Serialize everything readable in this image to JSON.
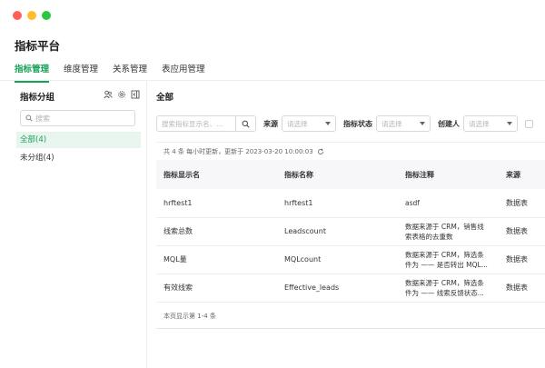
{
  "app": {
    "title": "指标平台"
  },
  "tabs": [
    "指标管理",
    "维度管理",
    "关系管理",
    "表应用管理"
  ],
  "sidebar": {
    "title": "指标分组",
    "search_placeholder": "搜索",
    "items": [
      {
        "label": "全部(4)",
        "active": true
      },
      {
        "label": "未分组(4)",
        "active": false
      }
    ]
  },
  "main": {
    "title": "全部",
    "search_placeholder": "搜索指标显示名、...",
    "filters": [
      {
        "label": "来源",
        "placeholder": "请选择"
      },
      {
        "label": "指标状态",
        "placeholder": "请选择"
      },
      {
        "label": "创建人",
        "placeholder": "请选择"
      }
    ],
    "summary": "共 4 条   每小时更新，更新于 2023-03-20 10:00:03",
    "columns": [
      "指标显示名",
      "指标名称",
      "指标注释",
      "来源"
    ],
    "rows": [
      {
        "display": "hrftest1",
        "name": "hrftest1",
        "note": "asdf",
        "note2": "",
        "source": "数据表"
      },
      {
        "display": "线索总数",
        "name": "Leadscount",
        "note": "数据来源于 CRM，销售线",
        "note2": "索表格的去重数",
        "source": "数据表"
      },
      {
        "display": "MQL量",
        "name": "MQLcount",
        "note": "数据来源于 CRM，筛选条",
        "note2": "件为 —— 是否转出 MQL...",
        "source": "数据表"
      },
      {
        "display": "有效线索",
        "name": "Effective_leads",
        "note": "数据来源于 CRM，筛选条",
        "note2": "件为 —— 线索反馈状态...",
        "source": "数据表"
      }
    ],
    "footer": "本页显示第 1-4 条"
  },
  "colors": {
    "accent": "#18a058",
    "active_bg": "#e8f5ee",
    "header_bg": "#f7f7f9"
  }
}
